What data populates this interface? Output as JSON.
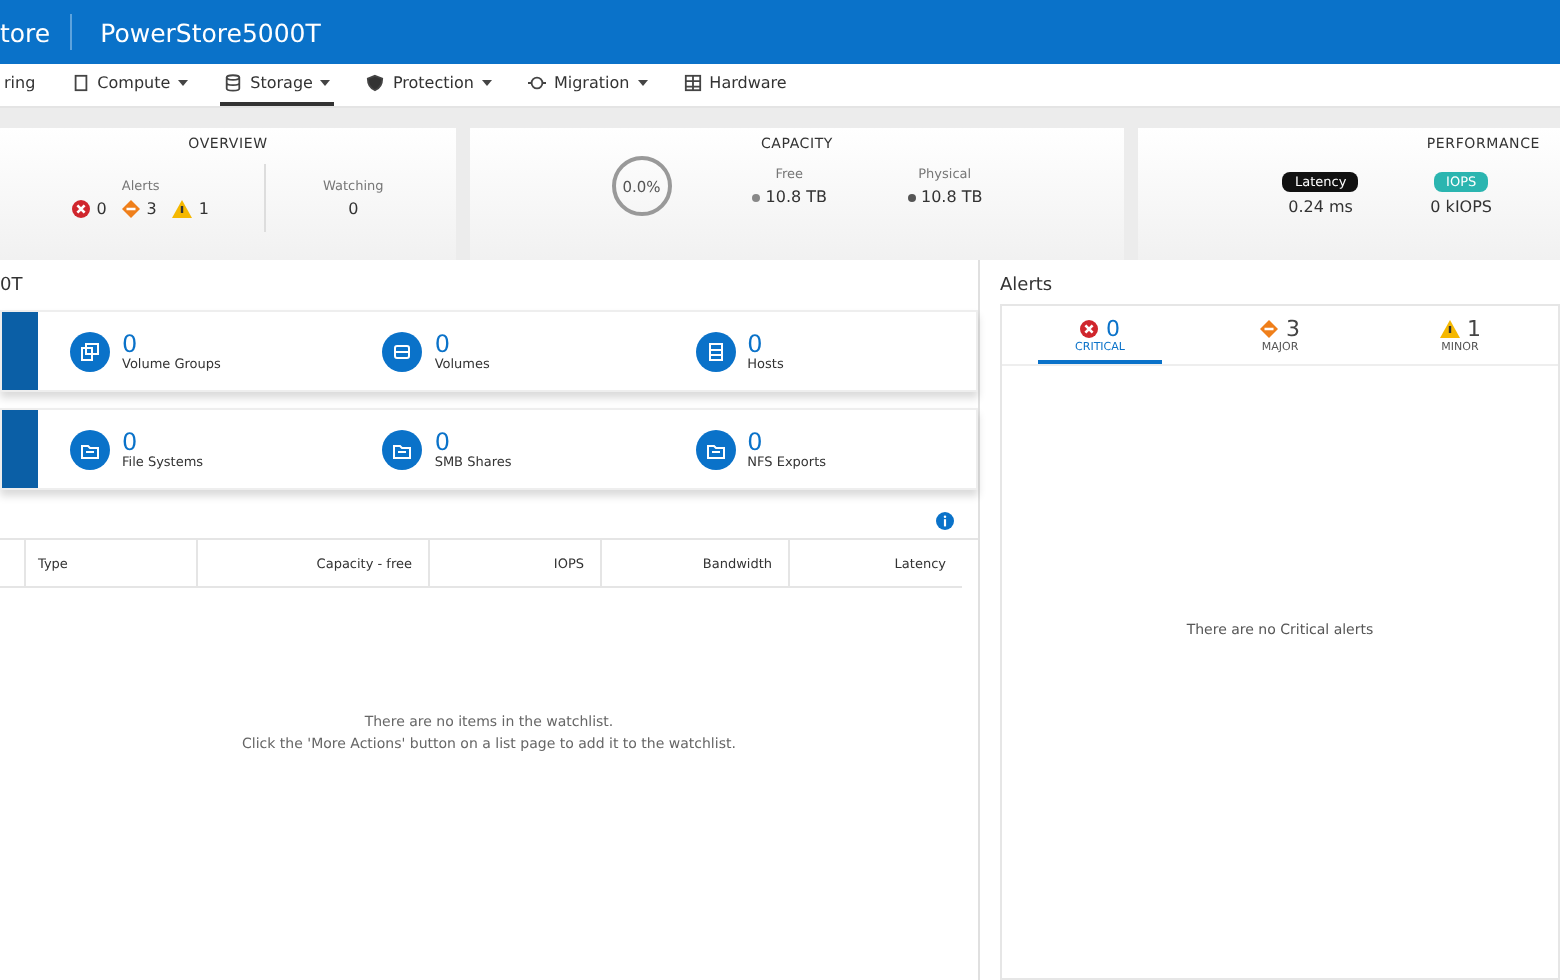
{
  "header": {
    "app": "tore",
    "system": "PowerStore5000T"
  },
  "nav": [
    {
      "label": "ring",
      "kind": "none",
      "dropdown": false,
      "selected": false
    },
    {
      "label": "Compute",
      "kind": "compute",
      "dropdown": true,
      "selected": false
    },
    {
      "label": "Storage",
      "kind": "storage",
      "dropdown": true,
      "selected": true
    },
    {
      "label": "Protection",
      "kind": "protection",
      "dropdown": true,
      "selected": false
    },
    {
      "label": "Migration",
      "kind": "migration",
      "dropdown": true,
      "selected": false
    },
    {
      "label": "Hardware",
      "kind": "hardware",
      "dropdown": false,
      "selected": false
    }
  ],
  "overview": {
    "title": "OVERVIEW",
    "alerts_label": "Alerts",
    "alerts": [
      {
        "kind": "critical",
        "count": "0"
      },
      {
        "kind": "major",
        "count": "3"
      },
      {
        "kind": "minor",
        "count": "1"
      }
    ],
    "watching_label": "Watching",
    "watching": "0"
  },
  "capacity": {
    "title": "CAPACITY",
    "percent": "0.0%",
    "free_label": "Free",
    "free": "10.8 TB",
    "physical_label": "Physical",
    "physical": "10.8 TB"
  },
  "performance": {
    "title": "PERFORMANCE",
    "metrics": [
      {
        "kind": "latency",
        "label": "Latency",
        "value": "0.24 ms"
      },
      {
        "kind": "iops",
        "label": "IOPS",
        "value": "0 kIOPS"
      }
    ]
  },
  "section_title": "0T",
  "stat_rows": [
    [
      {
        "kind": "groups",
        "count": "0",
        "label": "Volume Groups"
      },
      {
        "kind": "volume",
        "count": "0",
        "label": "Volumes"
      },
      {
        "kind": "host",
        "count": "0",
        "label": "Hosts"
      }
    ],
    [
      {
        "kind": "folder",
        "count": "0",
        "label": "File Systems"
      },
      {
        "kind": "folder",
        "count": "0",
        "label": "SMB Shares"
      },
      {
        "kind": "folder",
        "count": "0",
        "label": "NFS Exports"
      }
    ]
  ],
  "watchlist": {
    "columns": [
      "Type",
      "Capacity - free",
      "IOPS",
      "Bandwidth",
      "Latency"
    ],
    "empty_lines": [
      "There are no items in the watchlist.",
      "Click the 'More Actions' button on a list page to add it to the watchlist."
    ]
  },
  "alerts_panel": {
    "title": "Alerts",
    "tabs": [
      {
        "kind": "critical",
        "count": "0",
        "label": "CRITICAL",
        "selected": true
      },
      {
        "kind": "major",
        "count": "3",
        "label": "MAJOR",
        "selected": false
      },
      {
        "kind": "minor",
        "count": "1",
        "label": "MINOR",
        "selected": false
      }
    ],
    "empty": "There are no Critical alerts"
  }
}
